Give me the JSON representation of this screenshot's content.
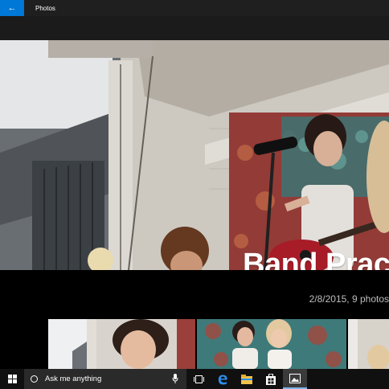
{
  "window": {
    "title": "Photos",
    "back_glyph": "←"
  },
  "hero": {
    "album_title": "Band Prac"
  },
  "album": {
    "meta": "2/8/2015, 9 photos"
  },
  "thumbnails": [
    {
      "label": "band-photo-1"
    },
    {
      "label": "band-photo-2"
    },
    {
      "label": "band-photo-3"
    }
  ],
  "taskbar": {
    "search_placeholder": "Ask me anything",
    "icons": [
      "windows-start-icon",
      "microphone-icon",
      "task-view-icon",
      "edge-browser-icon",
      "file-explorer-icon",
      "store-icon",
      "photos-app-icon"
    ]
  },
  "colors": {
    "accent": "#0078d7",
    "titlebar": "#1f1f1f",
    "taskbar": "#101010"
  }
}
